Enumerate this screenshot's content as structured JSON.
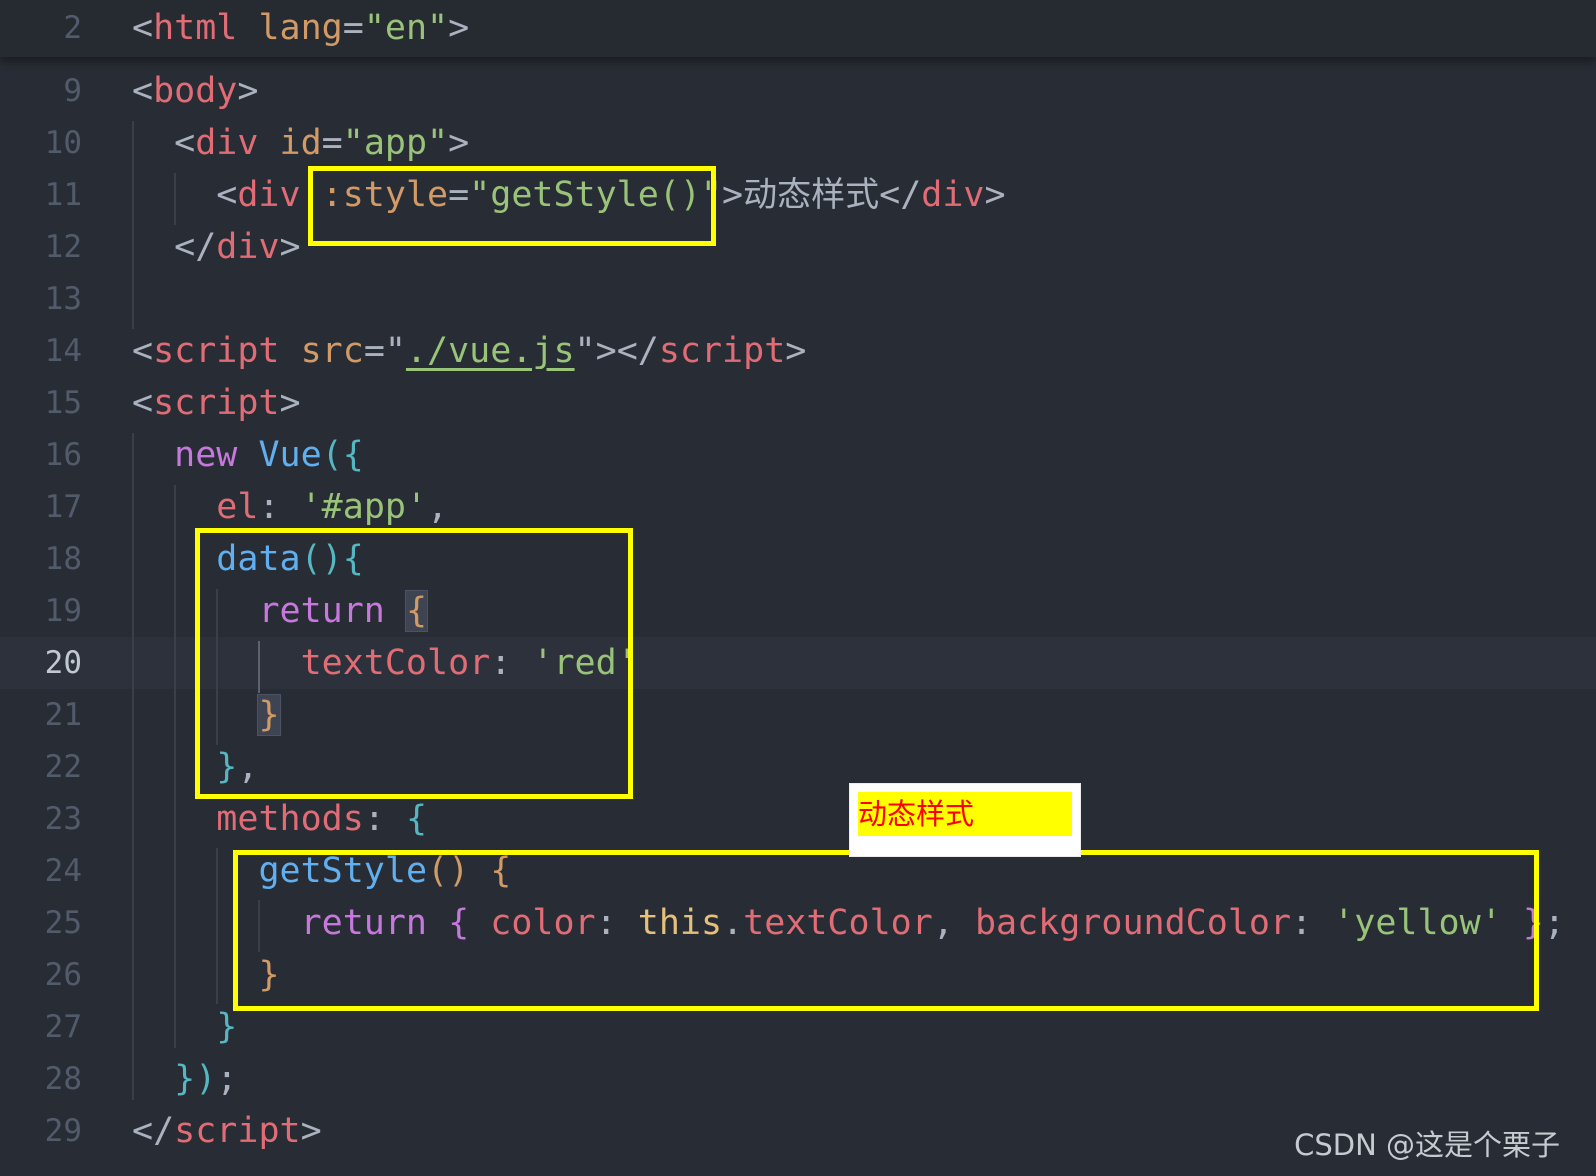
{
  "watermark": "CSDN @这是个栗子",
  "preview": {
    "text": "动态样式",
    "text_color": "#ff0000",
    "background_color": "#ffff00"
  },
  "lines": [
    {
      "number": "2",
      "parts": [
        [
          "punc",
          "<"
        ],
        [
          "tag",
          "html"
        ],
        [
          "punc",
          " "
        ],
        [
          "attr",
          "lang"
        ],
        [
          "punc",
          "="
        ],
        [
          "str",
          "\"en\""
        ],
        [
          "punc",
          ">"
        ]
      ]
    },
    {
      "number": "9",
      "parts": [
        [
          "punc",
          "<"
        ],
        [
          "tag",
          "body"
        ],
        [
          "punc",
          ">"
        ]
      ]
    },
    {
      "number": "10",
      "parts": [
        [
          "punc",
          "  <"
        ],
        [
          "tag",
          "div"
        ],
        [
          "punc",
          " "
        ],
        [
          "attr",
          "id"
        ],
        [
          "punc",
          "="
        ],
        [
          "str",
          "\"app\""
        ],
        [
          "punc",
          ">"
        ]
      ]
    },
    {
      "number": "11",
      "parts": [
        [
          "punc",
          "    <"
        ],
        [
          "tag",
          "div"
        ],
        [
          "punc",
          " "
        ],
        [
          "attr",
          ":style"
        ],
        [
          "punc",
          "="
        ],
        [
          "str",
          "\"getStyle()\""
        ],
        [
          "punc",
          ">"
        ],
        [
          "cjk",
          "动态样式"
        ],
        [
          "punc",
          "</"
        ],
        [
          "tag",
          "div"
        ],
        [
          "punc",
          ">"
        ]
      ]
    },
    {
      "number": "12",
      "parts": [
        [
          "punc",
          "  </"
        ],
        [
          "tag",
          "div"
        ],
        [
          "punc",
          ">"
        ]
      ]
    },
    {
      "number": "13",
      "parts": []
    },
    {
      "number": "14",
      "parts": [
        [
          "punc",
          "<"
        ],
        [
          "tag",
          "script"
        ],
        [
          "punc",
          " "
        ],
        [
          "attr",
          "src"
        ],
        [
          "punc",
          "=\""
        ],
        [
          "url",
          "./vue.js"
        ],
        [
          "punc",
          "\"></"
        ],
        [
          "tag",
          "script"
        ],
        [
          "punc",
          ">"
        ]
      ]
    },
    {
      "number": "15",
      "parts": [
        [
          "punc",
          "<"
        ],
        [
          "tag",
          "script"
        ],
        [
          "punc",
          ">"
        ]
      ]
    },
    {
      "number": "16",
      "parts": [
        [
          "punc",
          "  "
        ],
        [
          "kw",
          "new"
        ],
        [
          "punc",
          " "
        ],
        [
          "fn",
          "Vue"
        ],
        [
          "cyan",
          "({"
        ]
      ]
    },
    {
      "number": "17",
      "parts": [
        [
          "punc",
          "    "
        ],
        [
          "prop",
          "el"
        ],
        [
          "punc",
          ": "
        ],
        [
          "str",
          "'#app'"
        ],
        [
          "punc",
          ","
        ]
      ]
    },
    {
      "number": "18",
      "parts": [
        [
          "punc",
          "    "
        ],
        [
          "fn",
          "data"
        ],
        [
          "cyan",
          "(){"
        ]
      ]
    },
    {
      "number": "19",
      "parts": [
        [
          "punc",
          "      "
        ],
        [
          "kw",
          "return"
        ],
        [
          "punc",
          " "
        ],
        [
          "bracket",
          "{"
        ]
      ]
    },
    {
      "number": "20",
      "parts": [
        [
          "punc",
          "        "
        ],
        [
          "prop",
          "textColor"
        ],
        [
          "punc",
          ": "
        ],
        [
          "str",
          "'red'"
        ]
      ]
    },
    {
      "number": "21",
      "parts": [
        [
          "punc",
          "      "
        ],
        [
          "bracket",
          "}"
        ]
      ]
    },
    {
      "number": "22",
      "parts": [
        [
          "punc",
          "    "
        ],
        [
          "cyan",
          "}"
        ],
        [
          "punc",
          ","
        ]
      ]
    },
    {
      "number": "23",
      "parts": [
        [
          "punc",
          "    "
        ],
        [
          "prop",
          "methods"
        ],
        [
          "punc",
          ": "
        ],
        [
          "cyan",
          "{"
        ]
      ]
    },
    {
      "number": "24",
      "parts": [
        [
          "punc",
          "      "
        ],
        [
          "fn",
          "getStyle"
        ],
        [
          "gold",
          "()"
        ],
        [
          "punc",
          " "
        ],
        [
          "gold",
          "{"
        ]
      ]
    },
    {
      "number": "25",
      "parts": [
        [
          "punc",
          "        "
        ],
        [
          "kw",
          "return"
        ],
        [
          "punc",
          " "
        ],
        [
          "kw",
          "{"
        ],
        [
          "punc",
          " "
        ],
        [
          "prop",
          "color"
        ],
        [
          "punc",
          ": "
        ],
        [
          "cls",
          "this"
        ],
        [
          "punc",
          "."
        ],
        [
          "prop",
          "textColor"
        ],
        [
          "punc",
          ", "
        ],
        [
          "prop",
          "backgroundColor"
        ],
        [
          "punc",
          ": "
        ],
        [
          "str",
          "'yellow'"
        ],
        [
          "punc",
          " "
        ],
        [
          "kw",
          "}"
        ],
        [
          "punc",
          ";"
        ]
      ]
    },
    {
      "number": "26",
      "parts": [
        [
          "punc",
          "      "
        ],
        [
          "gold",
          "}"
        ]
      ]
    },
    {
      "number": "27",
      "parts": [
        [
          "punc",
          "    "
        ],
        [
          "cyan",
          "}"
        ]
      ]
    },
    {
      "number": "28",
      "parts": [
        [
          "punc",
          "  "
        ],
        [
          "cyan",
          "})"
        ],
        [
          "punc",
          ";"
        ]
      ]
    },
    {
      "number": "29",
      "parts": [
        [
          "punc",
          "</"
        ],
        [
          "tag",
          "script"
        ],
        [
          "punc",
          ">"
        ]
      ]
    }
  ]
}
